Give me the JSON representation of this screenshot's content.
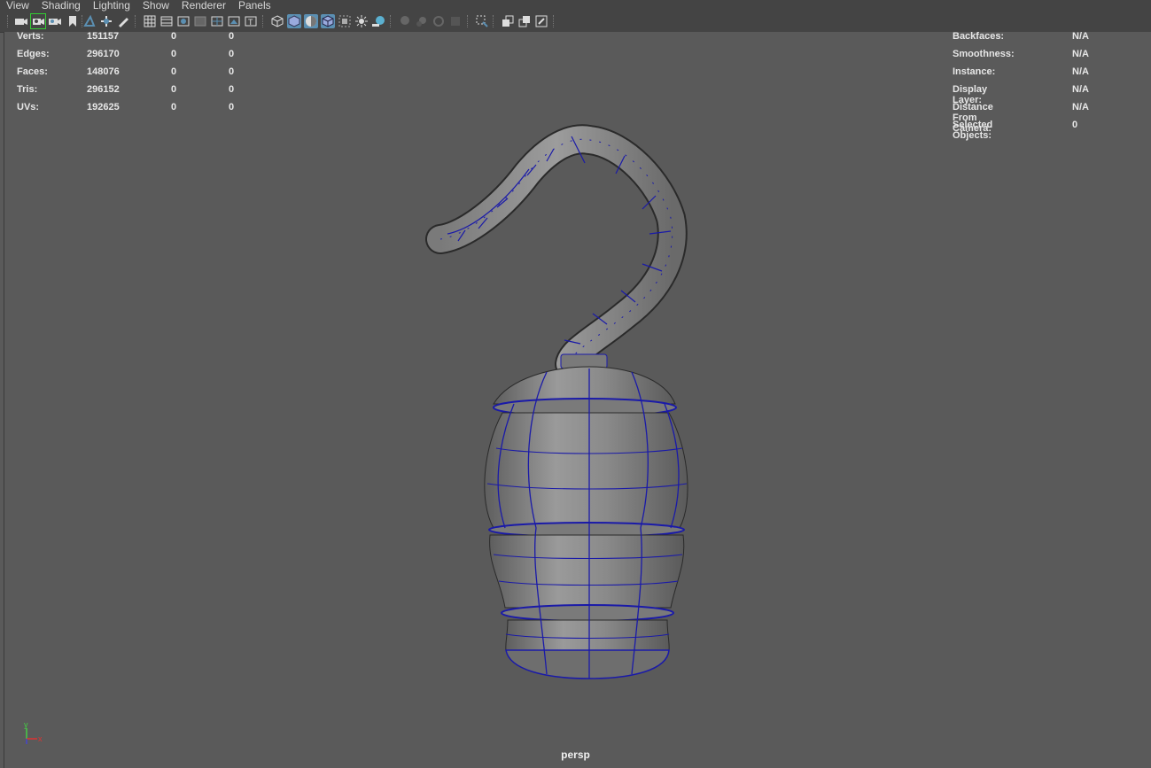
{
  "menu": [
    "View",
    "Shading",
    "Lighting",
    "Show",
    "Renderer",
    "Panels"
  ],
  "toolbar_icons": [
    "camera-select-icon",
    "camera-attributes-icon",
    "camera-video-icon",
    "bookmark-icon",
    "image-plane-icon",
    "pan-zoom-icon",
    "grease-pencil-icon",
    "grid-icon",
    "film-gate-icon",
    "resolution-gate-icon",
    "gate-mask-icon",
    "field-chart-icon",
    "safe-action-icon",
    "safe-title-icon",
    "wireframe-icon",
    "smooth-shade-icon",
    "shade-default-material-icon",
    "wireframe-on-shaded-icon",
    "xray-icon",
    "textured-icon",
    "use-all-lights-icon",
    "shadows-icon",
    "screen-space-ao-icon",
    "motion-blur-icon",
    "multisample-aa-icon",
    "depth-of-field-icon",
    "isolate-select-icon",
    "xray-active-components-icon",
    "camera-manipulator-icon",
    "single-panel-icon",
    "two-panes-icon",
    "maximize-panel-icon"
  ],
  "hud_left": {
    "rows": [
      {
        "label": "Verts:",
        "v1": "151157",
        "v2": "0",
        "v3": "0"
      },
      {
        "label": "Edges:",
        "v1": "296170",
        "v2": "0",
        "v3": "0"
      },
      {
        "label": "Faces:",
        "v1": "148076",
        "v2": "0",
        "v3": "0"
      },
      {
        "label": "Tris:",
        "v1": "296152",
        "v2": "0",
        "v3": "0"
      },
      {
        "label": "UVs:",
        "v1": "192625",
        "v2": "0",
        "v3": "0"
      }
    ]
  },
  "hud_right": {
    "rows": [
      {
        "label": "Backfaces:",
        "value": "N/A"
      },
      {
        "label": "Smoothness:",
        "value": "N/A"
      },
      {
        "label": "Instance:",
        "value": "N/A"
      },
      {
        "label": "Display Layer:",
        "value": "N/A"
      },
      {
        "label": "Distance From Camera:",
        "value": "N/A"
      },
      {
        "label": "Selected Objects:",
        "value": "0"
      }
    ]
  },
  "camera_label": "persp",
  "axis": {
    "y_label": "y",
    "x_label": "x"
  },
  "colors": {
    "wire": "#1a1aa8",
    "mesh": "#8a8a8a",
    "bg": "#5a5a5a",
    "active_tool": "#5b8fb2"
  }
}
